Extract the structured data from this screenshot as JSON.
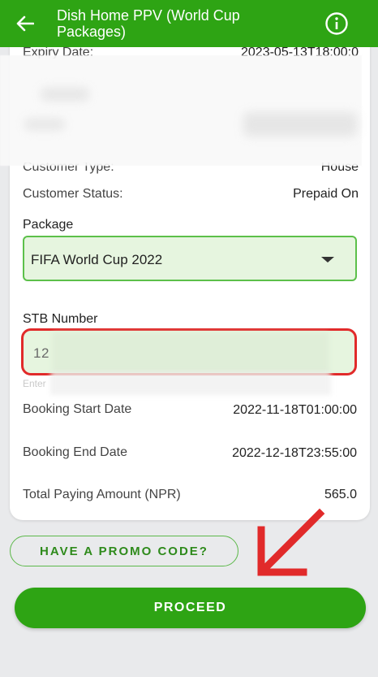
{
  "appbar": {
    "title": "Dish Home PPV (World Cup Packages)",
    "back_icon": "arrow-left-icon",
    "info_icon": "info-icon"
  },
  "details": {
    "expiry_label": "Expiry Date:",
    "expiry_value": "2023-05-13T18:00:0",
    "customer_type_label": "Customer Type:",
    "customer_type_value": "House",
    "customer_status_label": "Customer Status:",
    "customer_status_value": "Prepaid On"
  },
  "package": {
    "label": "Package",
    "selected": "FIFA World Cup 2022"
  },
  "stb": {
    "label": "STB Number",
    "value": "12",
    "helper": "Enter"
  },
  "booking": {
    "start_label": "Booking Start Date",
    "start_value": "2022-11-18T01:00:00",
    "end_label": "Booking End Date",
    "end_value": "2022-12-18T23:55:00",
    "amount_label": "Total Paying Amount (NPR)",
    "amount_value": "565.0"
  },
  "buttons": {
    "promo": "HAVE A PROMO CODE?",
    "proceed": "PROCEED"
  },
  "colors": {
    "brand_green": "#2ea414",
    "annotation_red": "#e12a2a"
  }
}
